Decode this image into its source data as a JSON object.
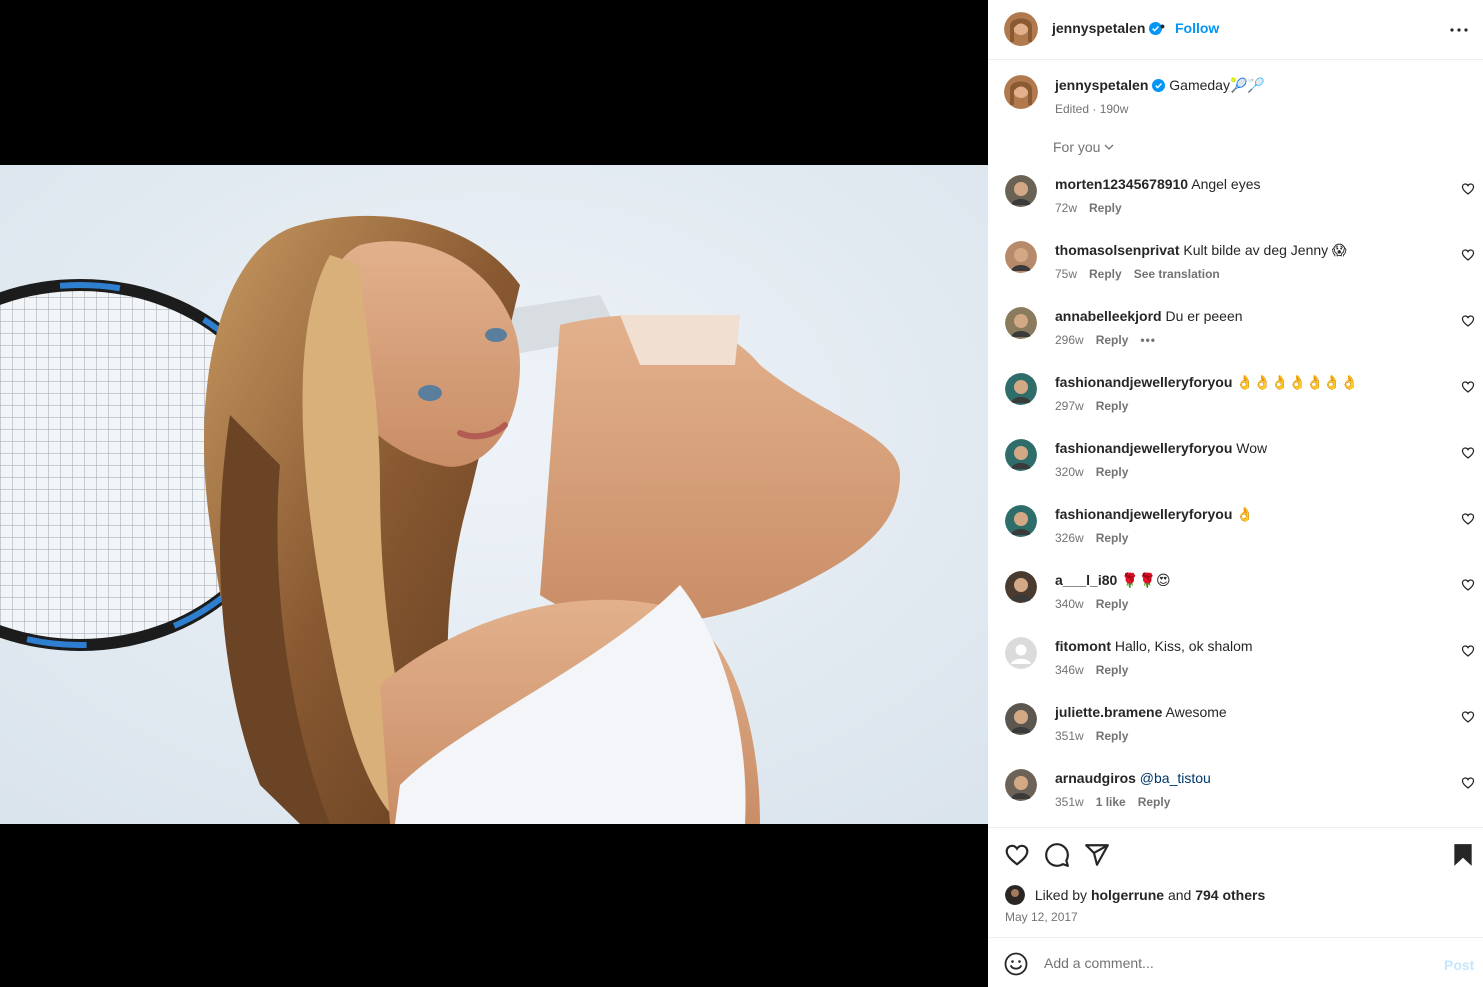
{
  "post": {
    "username": "jennyspetalen",
    "separator": "•",
    "follow_label": "Follow",
    "caption_text": "Gameday🎾🏸",
    "caption_meta": "Edited · 190w",
    "sort_label": "For you"
  },
  "comments": [
    {
      "user": "morten12345678910",
      "text": "Angel eyes",
      "age": "72w",
      "reply": "Reply",
      "av": "#6a6355"
    },
    {
      "user": "thomasolsenprivat",
      "text": "Kult bilde av deg Jenny 😱",
      "age": "75w",
      "reply": "Reply",
      "translate": "See translation",
      "av": "#b88a6c"
    },
    {
      "user": "annabelleekjord",
      "text": "Du er peeen",
      "age": "296w",
      "reply": "Reply",
      "more": "•••",
      "av": "#8a7a5e"
    },
    {
      "user": "fashionandjewelleryforyou",
      "text": "👌👌👌👌👌👌👌",
      "age": "297w",
      "reply": "Reply",
      "av": "#2e6d6a"
    },
    {
      "user": "fashionandjewelleryforyou",
      "text": "Wow",
      "age": "320w",
      "reply": "Reply",
      "av": "#2e6d6a"
    },
    {
      "user": "fashionandjewelleryforyou",
      "text": "👌",
      "age": "326w",
      "reply": "Reply",
      "av": "#2e6d6a"
    },
    {
      "user": "a___l_i80",
      "text": "🌹🌹😍",
      "age": "340w",
      "reply": "Reply",
      "av": "#4a3a30"
    },
    {
      "user": "fitomont",
      "text": "Hallo, Kiss, ok shalom",
      "age": "346w",
      "reply": "Reply",
      "av": "#dbdbdb"
    },
    {
      "user": "juliette.bramene",
      "text": "Awesome",
      "age": "351w",
      "reply": "Reply",
      "av": "#5b5750"
    },
    {
      "user": "arnaudgiros",
      "text": "@ba_tistou",
      "age": "351w",
      "likes": "1 like",
      "reply": "Reply",
      "av": "#6d6258",
      "mention": true
    }
  ],
  "likes": {
    "prefix": "Liked by",
    "user": "holgerrune",
    "and": "and",
    "others": "794 others"
  },
  "date": "May 12, 2017",
  "add_comment": {
    "placeholder": "Add a comment...",
    "post_label": "Post"
  },
  "icons": {
    "verified": "verified-badge-icon",
    "more": "more-horizontal-icon",
    "heart": "heart-icon",
    "comment": "comment-icon",
    "share": "share-icon",
    "save": "bookmark-icon",
    "emoji": "emoji-icon"
  },
  "colors": {
    "link_blue": "#0095f6",
    "secondary_text": "#737373",
    "verified_blue": "#0095f6"
  }
}
